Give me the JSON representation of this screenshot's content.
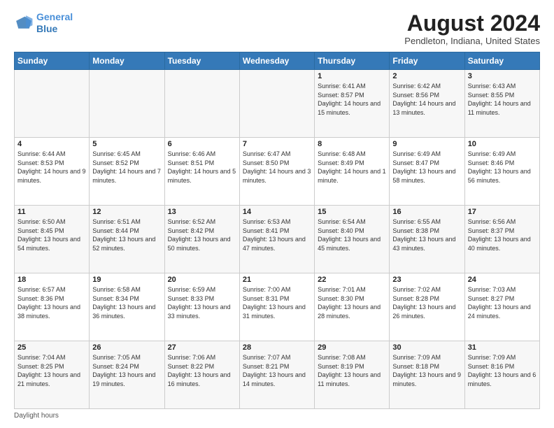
{
  "logo": {
    "line1": "General",
    "line2": "Blue"
  },
  "title": "August 2024",
  "subtitle": "Pendleton, Indiana, United States",
  "days_of_week": [
    "Sunday",
    "Monday",
    "Tuesday",
    "Wednesday",
    "Thursday",
    "Friday",
    "Saturday"
  ],
  "footer": "Daylight hours",
  "weeks": [
    [
      {
        "num": "",
        "sunrise": "",
        "sunset": "",
        "daylight": ""
      },
      {
        "num": "",
        "sunrise": "",
        "sunset": "",
        "daylight": ""
      },
      {
        "num": "",
        "sunrise": "",
        "sunset": "",
        "daylight": ""
      },
      {
        "num": "",
        "sunrise": "",
        "sunset": "",
        "daylight": ""
      },
      {
        "num": "1",
        "sunrise": "Sunrise: 6:41 AM",
        "sunset": "Sunset: 8:57 PM",
        "daylight": "Daylight: 14 hours and 15 minutes."
      },
      {
        "num": "2",
        "sunrise": "Sunrise: 6:42 AM",
        "sunset": "Sunset: 8:56 PM",
        "daylight": "Daylight: 14 hours and 13 minutes."
      },
      {
        "num": "3",
        "sunrise": "Sunrise: 6:43 AM",
        "sunset": "Sunset: 8:55 PM",
        "daylight": "Daylight: 14 hours and 11 minutes."
      }
    ],
    [
      {
        "num": "4",
        "sunrise": "Sunrise: 6:44 AM",
        "sunset": "Sunset: 8:53 PM",
        "daylight": "Daylight: 14 hours and 9 minutes."
      },
      {
        "num": "5",
        "sunrise": "Sunrise: 6:45 AM",
        "sunset": "Sunset: 8:52 PM",
        "daylight": "Daylight: 14 hours and 7 minutes."
      },
      {
        "num": "6",
        "sunrise": "Sunrise: 6:46 AM",
        "sunset": "Sunset: 8:51 PM",
        "daylight": "Daylight: 14 hours and 5 minutes."
      },
      {
        "num": "7",
        "sunrise": "Sunrise: 6:47 AM",
        "sunset": "Sunset: 8:50 PM",
        "daylight": "Daylight: 14 hours and 3 minutes."
      },
      {
        "num": "8",
        "sunrise": "Sunrise: 6:48 AM",
        "sunset": "Sunset: 8:49 PM",
        "daylight": "Daylight: 14 hours and 1 minute."
      },
      {
        "num": "9",
        "sunrise": "Sunrise: 6:49 AM",
        "sunset": "Sunset: 8:47 PM",
        "daylight": "Daylight: 13 hours and 58 minutes."
      },
      {
        "num": "10",
        "sunrise": "Sunrise: 6:49 AM",
        "sunset": "Sunset: 8:46 PM",
        "daylight": "Daylight: 13 hours and 56 minutes."
      }
    ],
    [
      {
        "num": "11",
        "sunrise": "Sunrise: 6:50 AM",
        "sunset": "Sunset: 8:45 PM",
        "daylight": "Daylight: 13 hours and 54 minutes."
      },
      {
        "num": "12",
        "sunrise": "Sunrise: 6:51 AM",
        "sunset": "Sunset: 8:44 PM",
        "daylight": "Daylight: 13 hours and 52 minutes."
      },
      {
        "num": "13",
        "sunrise": "Sunrise: 6:52 AM",
        "sunset": "Sunset: 8:42 PM",
        "daylight": "Daylight: 13 hours and 50 minutes."
      },
      {
        "num": "14",
        "sunrise": "Sunrise: 6:53 AM",
        "sunset": "Sunset: 8:41 PM",
        "daylight": "Daylight: 13 hours and 47 minutes."
      },
      {
        "num": "15",
        "sunrise": "Sunrise: 6:54 AM",
        "sunset": "Sunset: 8:40 PM",
        "daylight": "Daylight: 13 hours and 45 minutes."
      },
      {
        "num": "16",
        "sunrise": "Sunrise: 6:55 AM",
        "sunset": "Sunset: 8:38 PM",
        "daylight": "Daylight: 13 hours and 43 minutes."
      },
      {
        "num": "17",
        "sunrise": "Sunrise: 6:56 AM",
        "sunset": "Sunset: 8:37 PM",
        "daylight": "Daylight: 13 hours and 40 minutes."
      }
    ],
    [
      {
        "num": "18",
        "sunrise": "Sunrise: 6:57 AM",
        "sunset": "Sunset: 8:36 PM",
        "daylight": "Daylight: 13 hours and 38 minutes."
      },
      {
        "num": "19",
        "sunrise": "Sunrise: 6:58 AM",
        "sunset": "Sunset: 8:34 PM",
        "daylight": "Daylight: 13 hours and 36 minutes."
      },
      {
        "num": "20",
        "sunrise": "Sunrise: 6:59 AM",
        "sunset": "Sunset: 8:33 PM",
        "daylight": "Daylight: 13 hours and 33 minutes."
      },
      {
        "num": "21",
        "sunrise": "Sunrise: 7:00 AM",
        "sunset": "Sunset: 8:31 PM",
        "daylight": "Daylight: 13 hours and 31 minutes."
      },
      {
        "num": "22",
        "sunrise": "Sunrise: 7:01 AM",
        "sunset": "Sunset: 8:30 PM",
        "daylight": "Daylight: 13 hours and 28 minutes."
      },
      {
        "num": "23",
        "sunrise": "Sunrise: 7:02 AM",
        "sunset": "Sunset: 8:28 PM",
        "daylight": "Daylight: 13 hours and 26 minutes."
      },
      {
        "num": "24",
        "sunrise": "Sunrise: 7:03 AM",
        "sunset": "Sunset: 8:27 PM",
        "daylight": "Daylight: 13 hours and 24 minutes."
      }
    ],
    [
      {
        "num": "25",
        "sunrise": "Sunrise: 7:04 AM",
        "sunset": "Sunset: 8:25 PM",
        "daylight": "Daylight: 13 hours and 21 minutes."
      },
      {
        "num": "26",
        "sunrise": "Sunrise: 7:05 AM",
        "sunset": "Sunset: 8:24 PM",
        "daylight": "Daylight: 13 hours and 19 minutes."
      },
      {
        "num": "27",
        "sunrise": "Sunrise: 7:06 AM",
        "sunset": "Sunset: 8:22 PM",
        "daylight": "Daylight: 13 hours and 16 minutes."
      },
      {
        "num": "28",
        "sunrise": "Sunrise: 7:07 AM",
        "sunset": "Sunset: 8:21 PM",
        "daylight": "Daylight: 13 hours and 14 minutes."
      },
      {
        "num": "29",
        "sunrise": "Sunrise: 7:08 AM",
        "sunset": "Sunset: 8:19 PM",
        "daylight": "Daylight: 13 hours and 11 minutes."
      },
      {
        "num": "30",
        "sunrise": "Sunrise: 7:09 AM",
        "sunset": "Sunset: 8:18 PM",
        "daylight": "Daylight: 13 hours and 9 minutes."
      },
      {
        "num": "31",
        "sunrise": "Sunrise: 7:09 AM",
        "sunset": "Sunset: 8:16 PM",
        "daylight": "Daylight: 13 hours and 6 minutes."
      }
    ]
  ]
}
